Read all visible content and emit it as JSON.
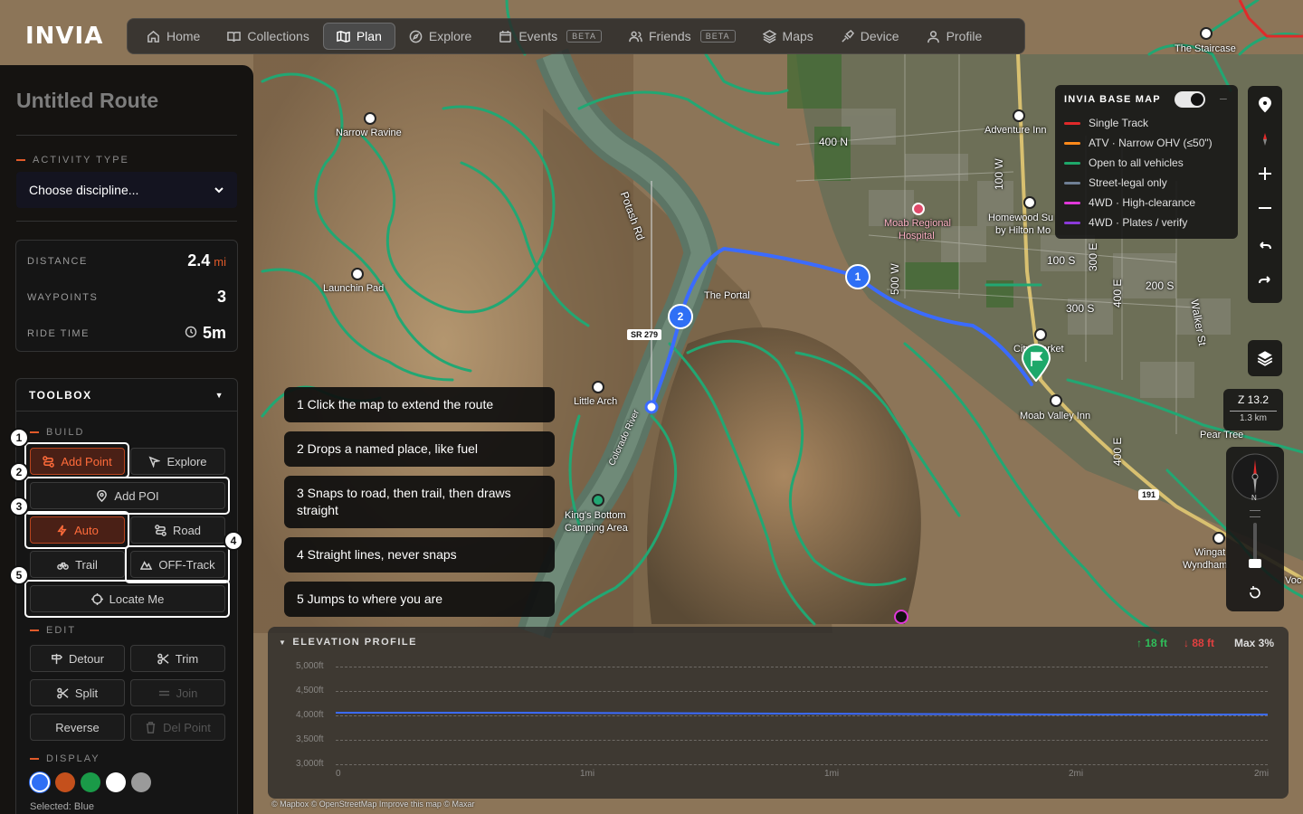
{
  "brand": "INVIA",
  "nav": [
    {
      "label": "Home",
      "icon": "home-icon"
    },
    {
      "label": "Collections",
      "icon": "book-icon"
    },
    {
      "label": "Plan",
      "icon": "map-icon",
      "active": true
    },
    {
      "label": "Explore",
      "icon": "compass-icon"
    },
    {
      "label": "Events",
      "icon": "calendar-icon",
      "badge": "BETA"
    },
    {
      "label": "Friends",
      "icon": "users-icon",
      "badge": "BETA"
    },
    {
      "label": "Maps",
      "icon": "layers-icon"
    },
    {
      "label": "Device",
      "icon": "device-icon"
    },
    {
      "label": "Profile",
      "icon": "user-icon"
    }
  ],
  "sidebar": {
    "route_title": "Untitled Route",
    "activity_type_label": "ACTIVITY TYPE",
    "discipline_value": "Choose discipline...",
    "stats": {
      "distance_label": "DISTANCE",
      "distance_value": "2.4",
      "distance_unit": "mi",
      "waypoints_label": "WAYPOINTS",
      "waypoints_value": "3",
      "ride_time_label": "RIDE TIME",
      "ride_time_value": "5m"
    },
    "toolbox": {
      "title": "TOOLBOX",
      "build_label": "BUILD",
      "add_point": "Add Point",
      "explore": "Explore",
      "add_poi": "Add POI",
      "auto": "Auto",
      "road": "Road",
      "trail": "Trail",
      "off_track": "OFF-Track",
      "locate_me": "Locate Me",
      "edit_label": "EDIT",
      "detour": "Detour",
      "trim": "Trim",
      "split": "Split",
      "join": "Join",
      "reverse": "Reverse",
      "del_point": "Del Point",
      "display_label": "DISPLAY",
      "colors": [
        "#2f6ff5",
        "#c4501c",
        "#1a9a48",
        "#ffffff",
        "#9a9a9a"
      ],
      "selected_color": "Selected: Blue"
    },
    "badges": [
      "1",
      "2",
      "3",
      "4",
      "5"
    ]
  },
  "tips": [
    "1 Click the map to extend the route",
    "2 Drops a named place, like fuel",
    "3 Snaps to road, then trail, then draws straight",
    "4 Straight lines, never snaps",
    "5 Jumps to where you are"
  ],
  "legend": {
    "title": "INVIA BASE MAP",
    "items": [
      {
        "label": "Single Track",
        "color": "#e02a2a"
      },
      {
        "label": "ATV · Narrow OHV (≤50\")",
        "color": "#ff8a1a"
      },
      {
        "label": "Open to all vehicles",
        "color": "#1ea86a"
      },
      {
        "label": "Street-legal only",
        "color": "#6f7f95"
      },
      {
        "label": "4WD · High-clearance",
        "color": "#e038d8"
      },
      {
        "label": "4WD · Plates / verify",
        "color": "#8a3ad8"
      }
    ]
  },
  "zoom": {
    "level": "Z 13.2",
    "scale": "1.3 km"
  },
  "compass": {
    "north": "N"
  },
  "map_labels": {
    "narrow_ravine": "Narrow Ravine",
    "launch_pad": "Launchin Pad",
    "potash_rd": "Potash Rd",
    "the_portal": "The Portal",
    "sr279": "SR 279",
    "little_arch": "Little Arch",
    "colorado_river": "Colorado River",
    "kings_bottom": "King's Bottom",
    "camping_area": "Camping Area",
    "adventure_inn": "Adventure Inn",
    "moab_regional": "Moab Regional",
    "hospital": "Hospital",
    "homewood": "Homewood Su",
    "by_hilton": "by Hilton Mo",
    "n400": "400 N",
    "w100": "100 W",
    "s100": "100 S",
    "s200": "200 S",
    "s300": "300 S",
    "w500": "500 W",
    "e300": "300 E",
    "e400": "400 E",
    "e400b": "400 E",
    "walker": "Walker St",
    "city_market": "City Market",
    "moab_valley_inn": "Moab Valley Inn",
    "peart_tree": "Pear Tree",
    "wingate": "Wingat",
    "wyndham": "Wyndham",
    "staircase": "The Staircase",
    "voc": "Voc",
    "us191": "191"
  },
  "waypoints": [
    "1",
    "2"
  ],
  "elevation": {
    "title": "ELEVATION PROFILE",
    "gain": "↑ 18 ft",
    "loss": "↓ 88 ft",
    "max": "Max 3%",
    "y_ticks": [
      "5,000ft",
      "4,500ft",
      "4,000ft",
      "3,500ft",
      "3,000ft"
    ],
    "x_ticks": [
      "0",
      "1mi",
      "1mi",
      "2mi",
      "2mi"
    ]
  },
  "attribution": "© Mapbox © OpenStreetMap Improve this map © Maxar"
}
